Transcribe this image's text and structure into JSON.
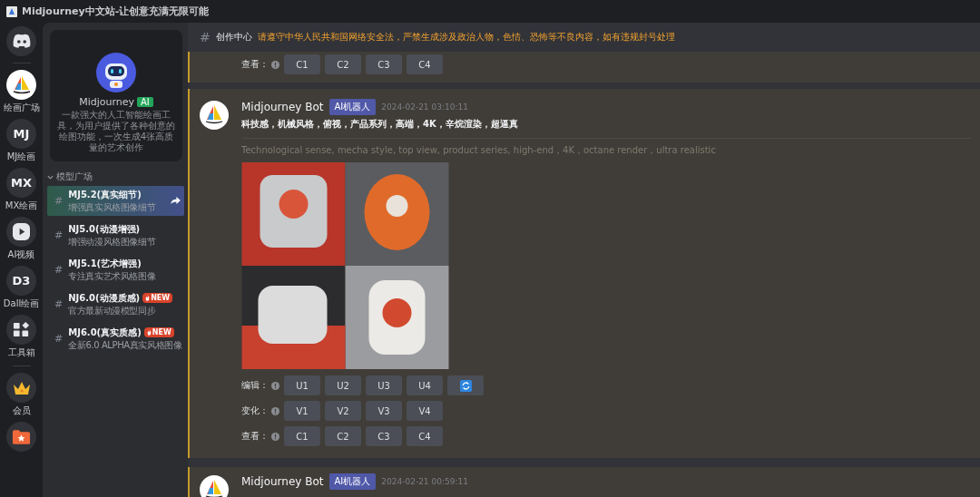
{
  "window": {
    "title": "Midjourney中文站-让创意充满无限可能"
  },
  "rail": {
    "items": [
      {
        "kind": "discord",
        "selected": false
      },
      {
        "kind": "divider"
      },
      {
        "kind": "logo",
        "label": "绘画广场",
        "selected": true
      },
      {
        "kind": "text",
        "mark": "MJ",
        "label": "MJ绘画",
        "selected": false
      },
      {
        "kind": "text",
        "mark": "MX",
        "label": "MX绘画",
        "selected": false
      },
      {
        "kind": "play",
        "label": "AI视频",
        "selected": false
      },
      {
        "kind": "text",
        "mark": "D3",
        "label": "Dall绘画",
        "selected": false
      },
      {
        "kind": "apps",
        "label": "工具箱",
        "selected": false
      },
      {
        "kind": "divider"
      },
      {
        "kind": "crown",
        "label": "会员",
        "selected": false
      },
      {
        "kind": "folder",
        "selected": false
      }
    ]
  },
  "sidebar": {
    "profile": {
      "name": "Midjourney",
      "badge": "AI",
      "description": "一款强大的人工智能绘画工具，为用户提供了各种创意的绘图功能，一次生成4张高质量的艺术创作"
    },
    "section": {
      "title": "模型广场",
      "expanded": true
    },
    "channels": [
      {
        "hash": "#",
        "title": "MJ5.2(真实细节)",
        "subtitle": "增强真实风格图像细节",
        "selected": true
      },
      {
        "hash": "#",
        "title": "NJ5.0(动漫增强)",
        "subtitle": "增强动漫风格图像细节",
        "selected": false
      },
      {
        "hash": "#",
        "title": "MJ5.1(艺术增强)",
        "subtitle": "专注真实艺术风格图像",
        "selected": false
      },
      {
        "hash": "#",
        "title": "NJ6.0(动漫质感)",
        "subtitle": "官方最新动漫模型同步",
        "badge": "NEW",
        "selected": false
      },
      {
        "hash": "#",
        "title": "MJ6.0(真实质感)",
        "subtitle": "全新6.0 ALPHA真实风格图像",
        "badge": "NEW",
        "selected": false
      }
    ]
  },
  "header": {
    "hash": "#",
    "title": "创作中心",
    "notice": "请遵守中华人民共和国网络安全法，严禁生成涉及政治人物，色情、恐怖等不良内容，如有违规封号处理"
  },
  "messages": [
    {
      "rows": [
        {
          "label": "查看：",
          "buttons": [
            "C1",
            "C2",
            "C3",
            "C4"
          ],
          "refresh": false
        }
      ]
    },
    {
      "author": "Midjourney Bot",
      "badge": "AI机器人",
      "time": "2024-02-21 03:10:11",
      "prompt": "科技感，机械风格，俯视，产品系列，高端，4K，辛烷渲染，超逼真",
      "prompt_en": "Technological sense, mecha style, top view, product series, high-end，4K，octane render，ultra realistic",
      "image": {
        "kind": "picture"
      },
      "rows": [
        {
          "label": "编辑：",
          "buttons": [
            "U1",
            "U2",
            "U3",
            "U4"
          ],
          "refresh": true
        },
        {
          "label": "变化：",
          "buttons": [
            "V1",
            "V2",
            "V3",
            "V4"
          ],
          "refresh": false
        },
        {
          "label": "查看：",
          "buttons": [
            "C1",
            "C2",
            "C3",
            "C4"
          ],
          "refresh": false
        }
      ]
    },
    {
      "author": "Midjourney Bot",
      "badge": "AI机器人",
      "time": "2024-02-21 00:59:11"
    }
  ]
}
